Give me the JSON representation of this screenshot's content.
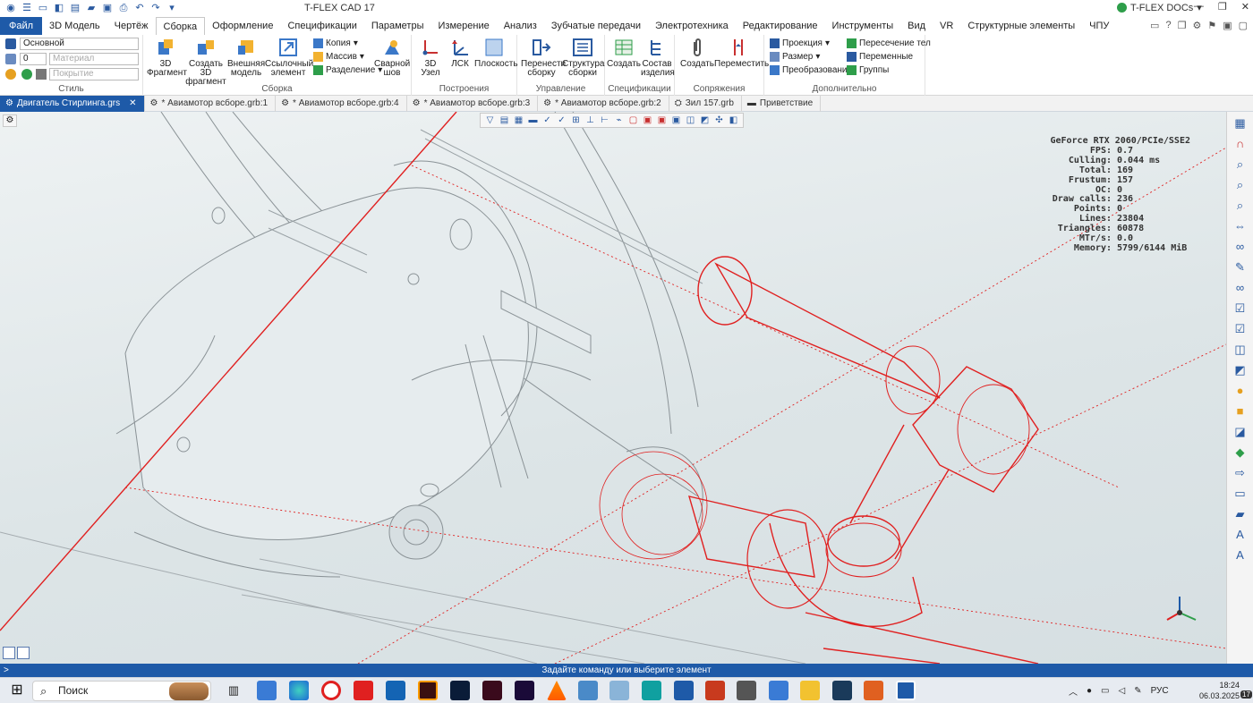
{
  "app": {
    "title": "T-FLEX CAD 17",
    "docs_label": "T-FLEX DOCs"
  },
  "menu_tabs": [
    "Файл",
    "3D Модель",
    "Чертёж",
    "Сборка",
    "Оформление",
    "Спецификации",
    "Параметры",
    "Измерение",
    "Анализ",
    "Зубчатые передачи",
    "Электротехника",
    "Редактирование",
    "Инструменты",
    "Вид",
    "VR",
    "Структурные элементы",
    "ЧПУ"
  ],
  "active_tab": "Сборка",
  "ribbon": {
    "style_group": {
      "label": "Стиль",
      "layer_value": "Основной",
      "level_value": "0",
      "material_placeholder": "Материал",
      "cover_placeholder": "Покрытие"
    },
    "assembly_group": {
      "label": "Сборка",
      "btn_3d_fragment": "3D Фрагмент",
      "btn_create_3d_fragment": "Создать 3D фрагмент",
      "btn_external_model": "Внешняя модель",
      "btn_ref_element": "Ссылочный элемент",
      "copy": "Копия",
      "array": "Массив",
      "split": "Разделение",
      "weld": "Сварной шов"
    },
    "build_group": {
      "label": "Построения",
      "node": "3D Узел",
      "lcs": "ЛСК",
      "plane": "Плоскость"
    },
    "manage_group": {
      "label": "Управление",
      "move_assembly": "Перенести сборку",
      "structure": "Структура сборки"
    },
    "spec_group": {
      "label": "Спецификации",
      "create": "Создать",
      "composition": "Состав изделия"
    },
    "mates_group": {
      "label": "Сопряжения",
      "create": "Создать",
      "move": "Переместить"
    },
    "extra_group": {
      "label": "Дополнительно",
      "projection": "Проекция",
      "size": "Размер",
      "transform": "Преобразования",
      "intersection": "Пересечение тел",
      "variables": "Переменные",
      "groups": "Группы"
    }
  },
  "doc_tabs": [
    "Двигатель Стирлинга.grs",
    "* Авиамотор всборе.grb:1",
    "* Авиамотор всборе.grb:4",
    "* Авиамотор всборе.grb:3",
    "* Авиамотор всборе.grb:2",
    "Зил 157.grb",
    "Приветствие"
  ],
  "stats": [
    {
      "k": "GeForce RTX 2060/PCIe/SSE2",
      "v": ""
    },
    {
      "k": "FPS:",
      "v": "0.7"
    },
    {
      "k": "Culling:",
      "v": "0.044 ms"
    },
    {
      "k": "Total:",
      "v": "169"
    },
    {
      "k": "Frustum:",
      "v": "157"
    },
    {
      "k": "OC:",
      "v": "0"
    },
    {
      "k": "Draw calls:",
      "v": "236"
    },
    {
      "k": "Points:",
      "v": "0"
    },
    {
      "k": "Lines:",
      "v": "23804"
    },
    {
      "k": "Triangles:",
      "v": "60878"
    },
    {
      "k": "MTr/s:",
      "v": "0.0"
    },
    {
      "k": "Memory:",
      "v": "5799/6144 MiB"
    }
  ],
  "status_message": "Задайте команду или выберите элемент",
  "taskbar": {
    "search_placeholder": "Поиск",
    "lang": "РУС",
    "time": "18:24",
    "date": "06.03.2025",
    "badge": "17"
  },
  "colors": {
    "accent": "#1e5aa8",
    "highlight_red": "#e02020"
  }
}
